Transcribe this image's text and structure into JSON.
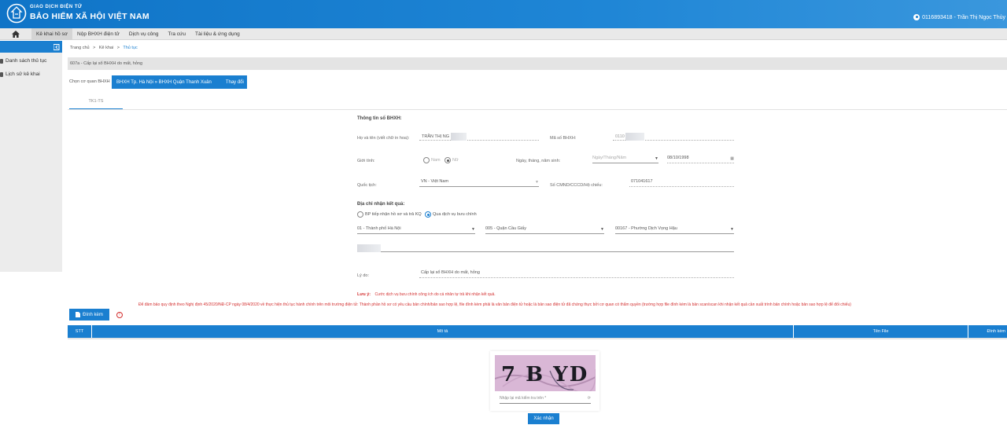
{
  "header": {
    "brand_small": "GIAO DỊCH ĐIỆN TỬ",
    "brand_big": "BẢO HIỂM XÃ HỘI VIỆT NAM",
    "user": "0116893418 - Trần Thị Ngọc Thủy"
  },
  "nav": {
    "items": [
      "Kê khai hồ sơ",
      "Nộp BHXH điện tử",
      "Dịch vụ công",
      "Tra cứu",
      "Tài liệu & ứng dụng"
    ]
  },
  "sidebar": {
    "items": [
      "Danh sách thủ tục",
      "Lịch sử kê khai"
    ]
  },
  "breadcrumb": [
    "Trang chủ",
    ">",
    "Kê khai",
    ">",
    "Thủ tục"
  ],
  "procedure": "607a - Cấp lại sổ BHXH do mất, hỏng",
  "agency": {
    "label": "Chọn cơ quan BHXH",
    "value": "BHXH Tp. Hà Nội » BHXH Quận Thanh Xuân",
    "change": "Thay đổi"
  },
  "tab": "TK1-TS",
  "form": {
    "section_info": "Thông tin sổ BHXH:",
    "name_label": "Họ và tên (viết chữ in hoa):",
    "name_value": "TRẦN THỊ NG",
    "bhxh_label": "Mã số BHXH:",
    "bhxh_value": "0110",
    "gender_label": "Giới tính:",
    "gender_male": "Nam",
    "gender_female": "Nữ",
    "dob_label": "Ngày, tháng, năm sinh:",
    "dob_format": "Ngày/Tháng/Năm",
    "dob_value": "08/10/1998",
    "nationality_label": "Quốc tịch:",
    "nationality_value": "VN - Việt Nam",
    "id_label": "Số CMND/CCCD/Hộ chiếu:",
    "id_value": "071041617",
    "section_address": "Địa chỉ nhận kết quả:",
    "recv_option1": "BP tiếp nhận hồ sơ và trả KQ",
    "recv_option2": "Qua dịch vụ bưu chính",
    "province": "01 - Thành phố Hà Nội",
    "district": "005 - Quận Cầu Giấy",
    "ward": "00167 - Phường Dịch Vọng Hậu",
    "reason_label": "Lý do:",
    "reason_value": "Cấp lại sổ BHXH do mất, hỏng"
  },
  "notes": {
    "label": "Lưu ý:",
    "note1": "Cước dịch vụ bưu chính công ích do cá nhân tự trả khi nhận kết quả.",
    "note2": "Để đảm bảo quy định theo Nghị định 45/2020/NĐ-CP ngày 08/4/2020 về thực hiện thủ tục hành chính trên môi trường điện tử: Thành phần hồ sơ có yêu cầu bản chính/bản sao hợp lệ, file đính kèm phải là văn bản điện tử hoặc là bản sao điện tử đã chứng thực bởi cơ quan có thẩm quyền (trường hợp file đính kèm là bản scan/scan khi nhận kết quả cần xuất trình bản chính hoặc bản sao hợp lệ để đối chiếu)"
  },
  "attach": {
    "label": "Đính kèm"
  },
  "table": {
    "columns": [
      "STT",
      "Mô tả",
      "Tên File",
      "Đính kèm"
    ]
  },
  "captcha": {
    "text": "7 B YD",
    "placeholder": "Nhập lại mã kiểm tra trên *",
    "confirm": "Xác nhận"
  },
  "colors": {
    "primary": "#1a7fd0",
    "warning": "#d32f2f"
  }
}
